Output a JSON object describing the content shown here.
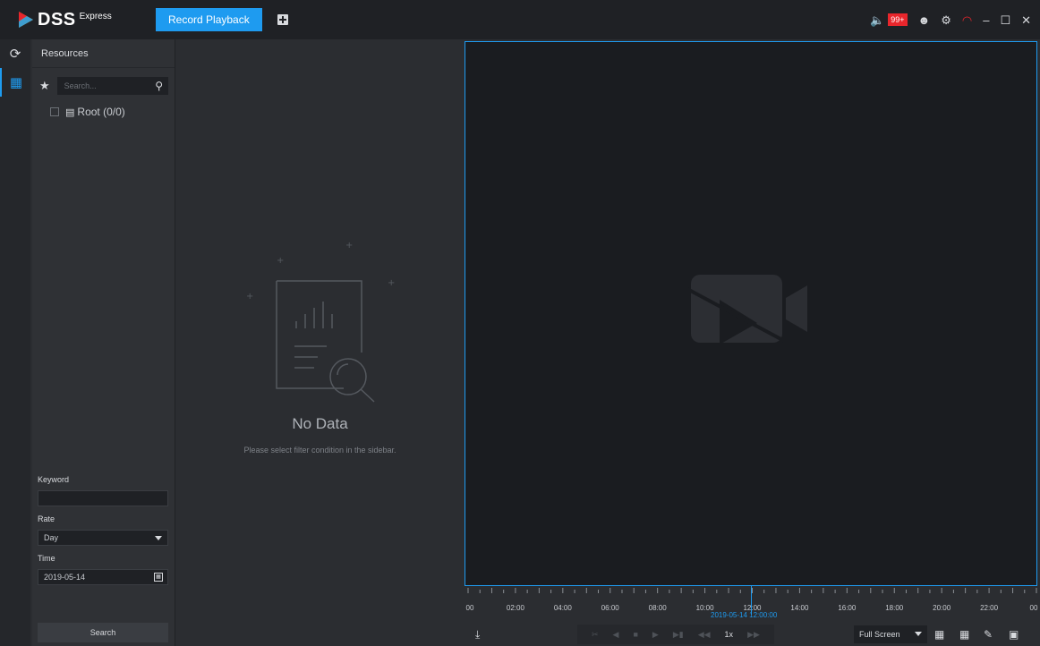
{
  "app": {
    "logo_text": "DSS",
    "logo_sub": "Express",
    "active_tab": "Record Playback",
    "notification_count": "99+"
  },
  "sidebar": {
    "title": "Resources",
    "search_placeholder": "Search...",
    "tree_root": "Root (0/0)"
  },
  "filters": {
    "keyword_label": "Keyword",
    "keyword_value": "",
    "rate_label": "Rate",
    "rate_value": "Day",
    "time_label": "Time",
    "time_value": "2019-05-14",
    "search_button": "Search"
  },
  "empty_state": {
    "title": "No Data",
    "subtitle": "Please select filter condition in the sidebar."
  },
  "timeline": {
    "labels": [
      "00",
      "02:00",
      "04:00",
      "06:00",
      "08:00",
      "10:00",
      "12:00",
      "14:00",
      "16:00",
      "18:00",
      "20:00",
      "22:00",
      "00"
    ],
    "cursor_time": "2019-05-14 12:00:00"
  },
  "controls": {
    "speed": "1x",
    "screen_mode": "Full Screen"
  },
  "colors": {
    "accent": "#1e9bf0",
    "alert": "#e8262c",
    "background": "#2b2d31"
  }
}
